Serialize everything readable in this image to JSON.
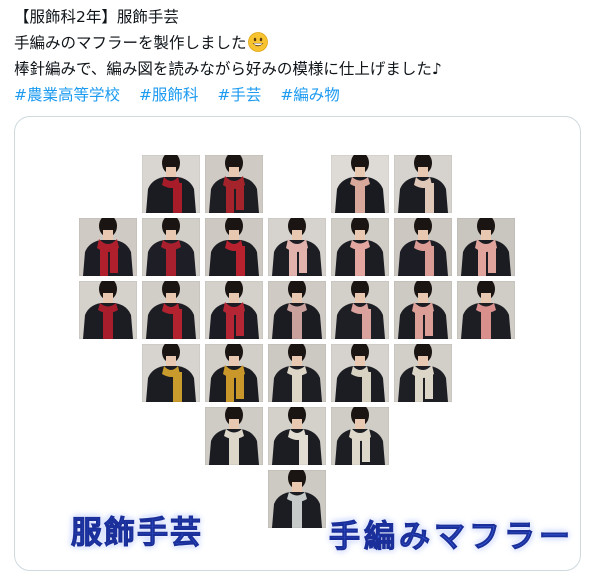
{
  "tweet": {
    "line1": "【服飾科2年】服飾手芸",
    "line2": "手編みのマフラーを製作しました",
    "line2_emoji": "grinning-face-emoji",
    "line3": "棒針編みで、編み図を読みながら好みの模様に仕上げました♪",
    "hashtags": [
      "#農業高等学校",
      "#服飾科",
      "#手芸",
      "#編み物"
    ]
  },
  "image": {
    "caption_left": "服飾手芸",
    "caption_right": "手編みマフラー",
    "caption_color": "#3a5fe0",
    "tiles": [
      {
        "scarf": "#a81c2a",
        "bg": "#d9d6d2",
        "coat": "#1b1c22"
      },
      {
        "scarf": "#a5242b",
        "bg": "#cfcbc4",
        "coat": "#1d1e24"
      },
      {
        "scarf": "#d8a99a",
        "bg": "#dedbd6",
        "coat": "#1a1b20"
      },
      {
        "scarf": "#e0c8b9",
        "bg": "#d6d3ce",
        "coat": "#1c1d23"
      },
      {
        "scarf": "#b01f2c",
        "bg": "#cfcac3",
        "coat": "#1c1d24"
      },
      {
        "scarf": "#a81f2d",
        "bg": "#d2cec8",
        "coat": "#1e1f26"
      },
      {
        "scarf": "#b8222e",
        "bg": "#cdc9c2",
        "coat": "#1b1c22"
      },
      {
        "scarf": "#e2b2ac",
        "bg": "#d6d3ce",
        "coat": "#1d1e24"
      },
      {
        "scarf": "#e3a7a0",
        "bg": "#d0ccc6",
        "coat": "#1c1d23"
      },
      {
        "scarf": "#dc9c96",
        "bg": "#ccc8c1",
        "coat": "#1d1e25"
      },
      {
        "scarf": "#e1a49d",
        "bg": "#c9c5bf",
        "coat": "#1b1c22"
      },
      {
        "scarf": "#a81d2b",
        "bg": "#d5d1cb",
        "coat": "#1c1d23"
      },
      {
        "scarf": "#b3222f",
        "bg": "#d1cdc7",
        "coat": "#1d1e24"
      },
      {
        "scarf": "#b52634",
        "bg": "#d4d0ca",
        "coat": "#1c1d24"
      },
      {
        "scarf": "#c9a09b",
        "bg": "#cfcbc4",
        "coat": "#1b1c22"
      },
      {
        "scarf": "#d9a29c",
        "bg": "#d3cfc9",
        "coat": "#1e1f25"
      },
      {
        "scarf": "#dc9f98",
        "bg": "#cdc9c3",
        "coat": "#1c1d23"
      },
      {
        "scarf": "#d98f8c",
        "bg": "#d0ccc6",
        "coat": "#1d1e24"
      },
      {
        "scarf": "#c99a2c",
        "bg": "#d7d4cf",
        "coat": "#1c1d23"
      },
      {
        "scarf": "#c9972a",
        "bg": "#d2cec8",
        "coat": "#1b1c22"
      },
      {
        "scarf": "#ddd6c6",
        "bg": "#ccc8c2",
        "coat": "#1d1e24"
      },
      {
        "scarf": "#d8d2c2",
        "bg": "#d6d3ce",
        "coat": "#1c1d23"
      },
      {
        "scarf": "#dcd6c8",
        "bg": "#d2cec8",
        "coat": "#1e1f25"
      },
      {
        "scarf": "#ddd7ca",
        "bg": "#cfcbc5",
        "coat": "#1b1c22"
      },
      {
        "scarf": "#e2ddd2",
        "bg": "#d4d0ca",
        "coat": "#1c1d23"
      },
      {
        "scarf": "#ded8cb",
        "bg": "#d0ccc6",
        "coat": "#1d1e24"
      },
      {
        "scarf": "#c6cbc9",
        "bg": "#cdc9c3",
        "coat": "#1c1d23"
      },
      {
        "scarf": "#6e6670",
        "bg": "#d3cfc9",
        "coat": "#1b1c22"
      }
    ]
  }
}
